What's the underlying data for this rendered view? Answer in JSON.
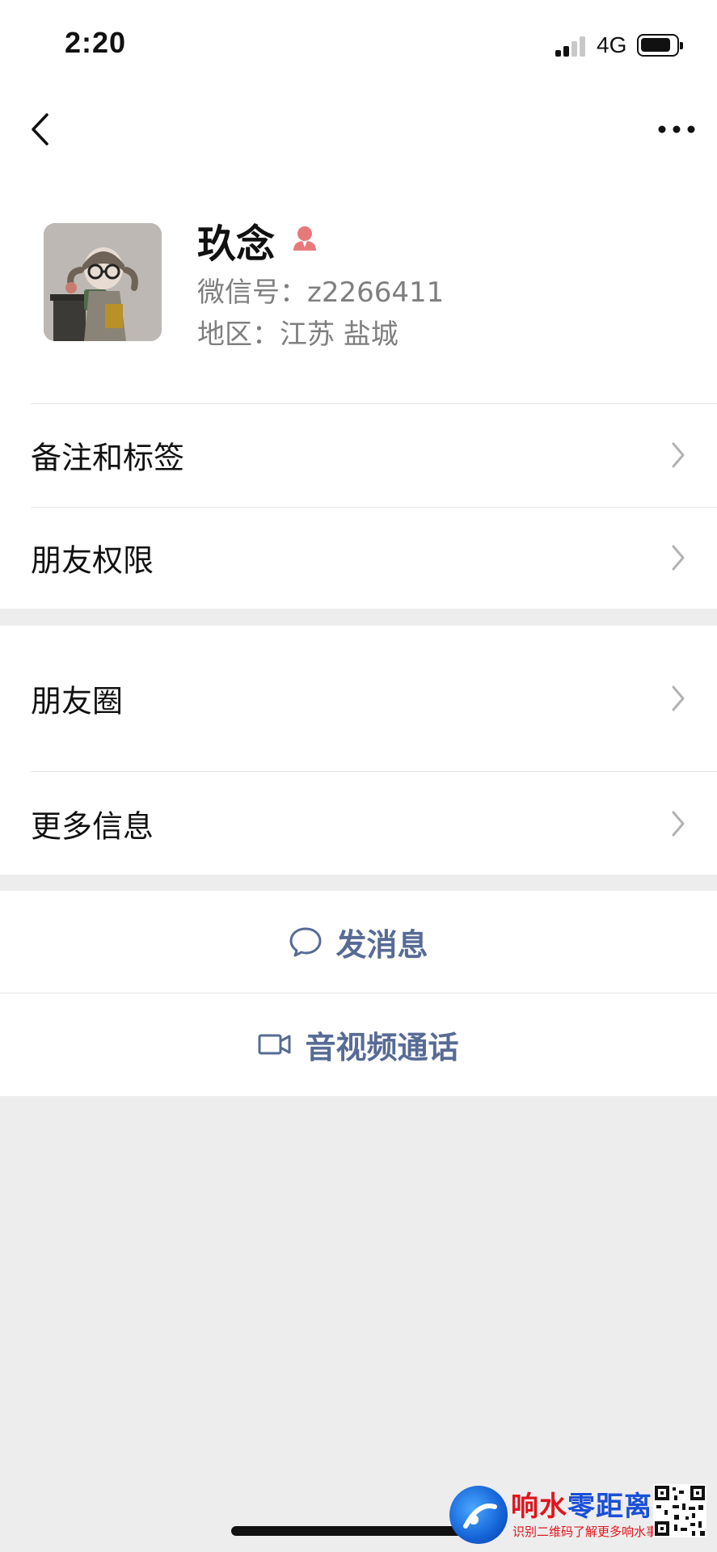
{
  "status_bar": {
    "time": "2:20",
    "network": "4G"
  },
  "nav": {
    "back_icon": "chevron-left-icon",
    "more_icon": "ellipsis-icon"
  },
  "profile": {
    "name": "玖念",
    "gender_icon": "female-icon",
    "gender_color": "#e8797a",
    "wechat_id_line": "微信号：z2266411",
    "region_line": "地区：江苏 盐城"
  },
  "menu_group_1": [
    {
      "label": "备注和标签"
    },
    {
      "label": "朋友权限"
    }
  ],
  "menu_group_2": [
    {
      "label": "朋友圈"
    },
    {
      "label": "更多信息"
    }
  ],
  "actions": {
    "message": {
      "label": "发消息",
      "icon": "chat-bubble-icon"
    },
    "call": {
      "label": "音视频通话",
      "icon": "video-camera-icon"
    },
    "accent_color": "#576b95"
  },
  "watermark": {
    "title_red": "响水",
    "title_blue": "零距离",
    "subtitle": "识别二维码了解更多响水事"
  }
}
